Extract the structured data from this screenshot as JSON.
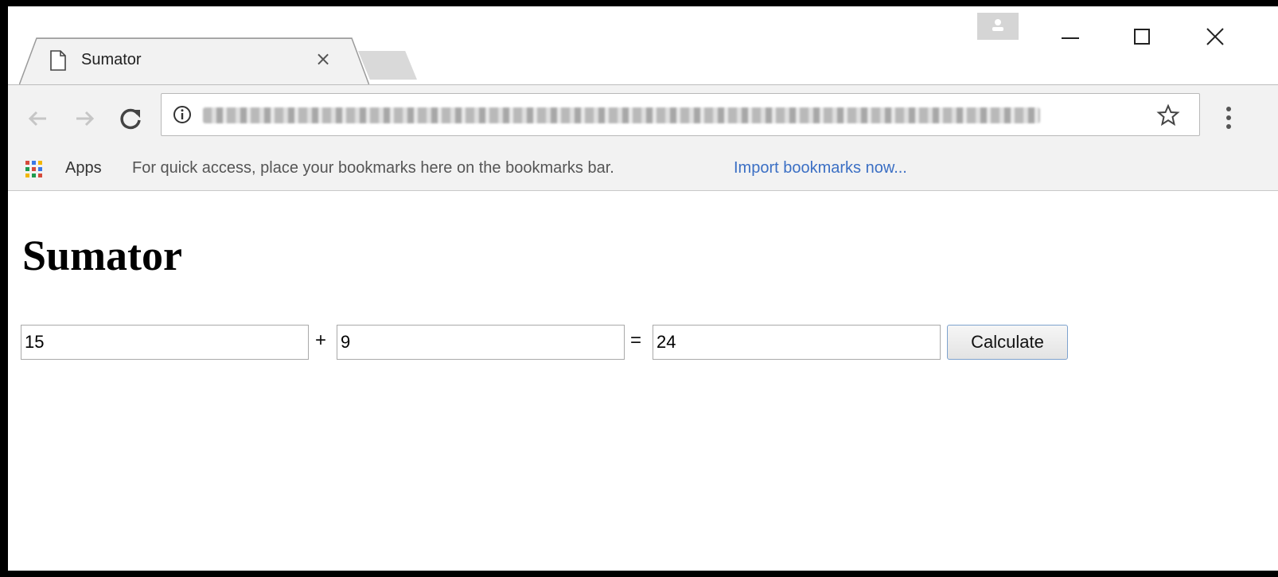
{
  "browser": {
    "tab": {
      "title": "Sumator",
      "close_glyph": "×"
    },
    "window_controls": {
      "minimize": "—",
      "maximize": "☐",
      "close": "✕"
    },
    "toolbar": {
      "back_icon": "arrow-left-icon",
      "forward_icon": "arrow-right-icon",
      "reload_icon": "reload-icon",
      "url_blurred": true,
      "bookmark_star_icon": "star-icon",
      "menu_icon": "vertical-dots-icon"
    },
    "bookmarks_bar": {
      "apps_label": "Apps",
      "hint_text": "For quick access, place your bookmarks here on the bookmarks bar.",
      "import_link": "Import bookmarks now..."
    }
  },
  "page": {
    "title": "Sumator",
    "first_number": "15",
    "plus_sign": "+",
    "second_number": "9",
    "equals_sign": "=",
    "result": "24",
    "calculate_label": "Calculate"
  },
  "colors": {
    "link": "#3b6fc4",
    "button_border": "#7da2ce",
    "chrome_bg": "#f2f2f2"
  }
}
